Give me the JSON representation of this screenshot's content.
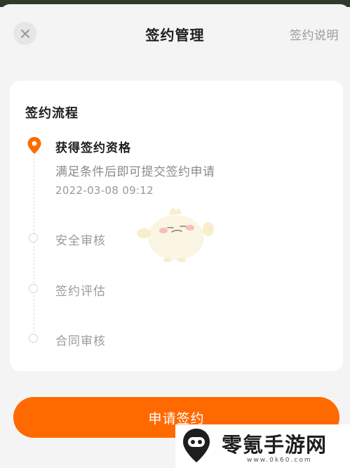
{
  "header": {
    "title": "签约管理",
    "link": "签约说明"
  },
  "card": {
    "title": "签约流程",
    "steps": [
      {
        "title": "获得签约资格",
        "desc": "满足条件后即可提交签约申请",
        "time": "2022-03-08 09:12",
        "status": "active"
      },
      {
        "title": "安全审核",
        "status": "pending"
      },
      {
        "title": "签约评估",
        "status": "pending"
      },
      {
        "title": "合同审核",
        "status": "pending"
      }
    ]
  },
  "apply_button": {
    "label": "申请签约"
  },
  "watermark": {
    "brand": "零氪手游网",
    "url": "www.0k60.com"
  },
  "colors": {
    "accent": "#ff6a00",
    "background": "#f4f4f4",
    "card": "#ffffff"
  },
  "icons": {
    "close": "close-icon",
    "active_step": "location-pin-icon",
    "pending_step": "circle-outline-icon"
  }
}
